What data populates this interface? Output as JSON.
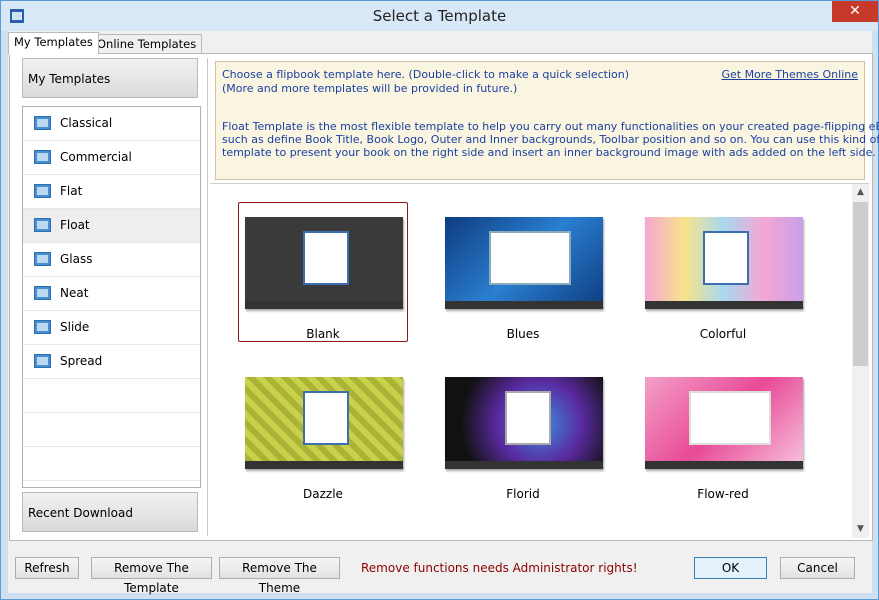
{
  "window": {
    "title": "Select a Template",
    "close_glyph": "✕"
  },
  "tabs": [
    {
      "label": "My Templates"
    },
    {
      "label": "Online Templates"
    }
  ],
  "left_panel": {
    "group_header": "My Templates",
    "items": [
      {
        "label": "Classical"
      },
      {
        "label": "Commercial"
      },
      {
        "label": "Flat"
      },
      {
        "label": "Float"
      },
      {
        "label": "Glass"
      },
      {
        "label": "Neat"
      },
      {
        "label": "Slide"
      },
      {
        "label": "Spread"
      }
    ],
    "selected_item": "Float",
    "recent_button": "Recent Download"
  },
  "info": {
    "line1": "Choose a flipbook template here. (Double-click to make a quick selection)",
    "line2": "(More and more templates will be provided in future.)",
    "desc1": "Float Template is the most flexible template to help you carry out many functionalities on your created page-flipping eBook,",
    "desc2": "such as define Book Title, Book Logo, Outer and Inner backgrounds, Toolbar position and so on. You can use this kind of",
    "desc3": "template to present your book on the right side and insert an inner background image with ads added on the left side.",
    "link": "Get More Themes Online"
  },
  "gallery": {
    "themes": [
      {
        "label": "Blank",
        "bg": "#3a3a3a",
        "selected": true
      },
      {
        "label": "Blues",
        "bg": "#1d4fa0",
        "selected": false
      },
      {
        "label": "Colorful",
        "bg": "#e8a0d0",
        "selected": false
      },
      {
        "label": "Dazzle",
        "bg": "#c9d14a",
        "selected": false
      },
      {
        "label": "Florid",
        "bg": "#1a1a2a",
        "selected": false
      },
      {
        "label": "Flow-red",
        "bg": "#f06aa8",
        "selected": false
      }
    ]
  },
  "buttons": {
    "refresh": "Refresh",
    "remove_template": "Remove The Template",
    "remove_theme": "Remove The Theme",
    "ok": "OK",
    "cancel": "Cancel"
  },
  "warning": "Remove functions needs Administrator rights!",
  "colors": {
    "accent": "#5b9bd5",
    "warning": "#8b0000",
    "link": "#1a3fa0",
    "close": "#c7392b"
  },
  "icons": {
    "app": "book-icon",
    "list": "template-icon"
  }
}
